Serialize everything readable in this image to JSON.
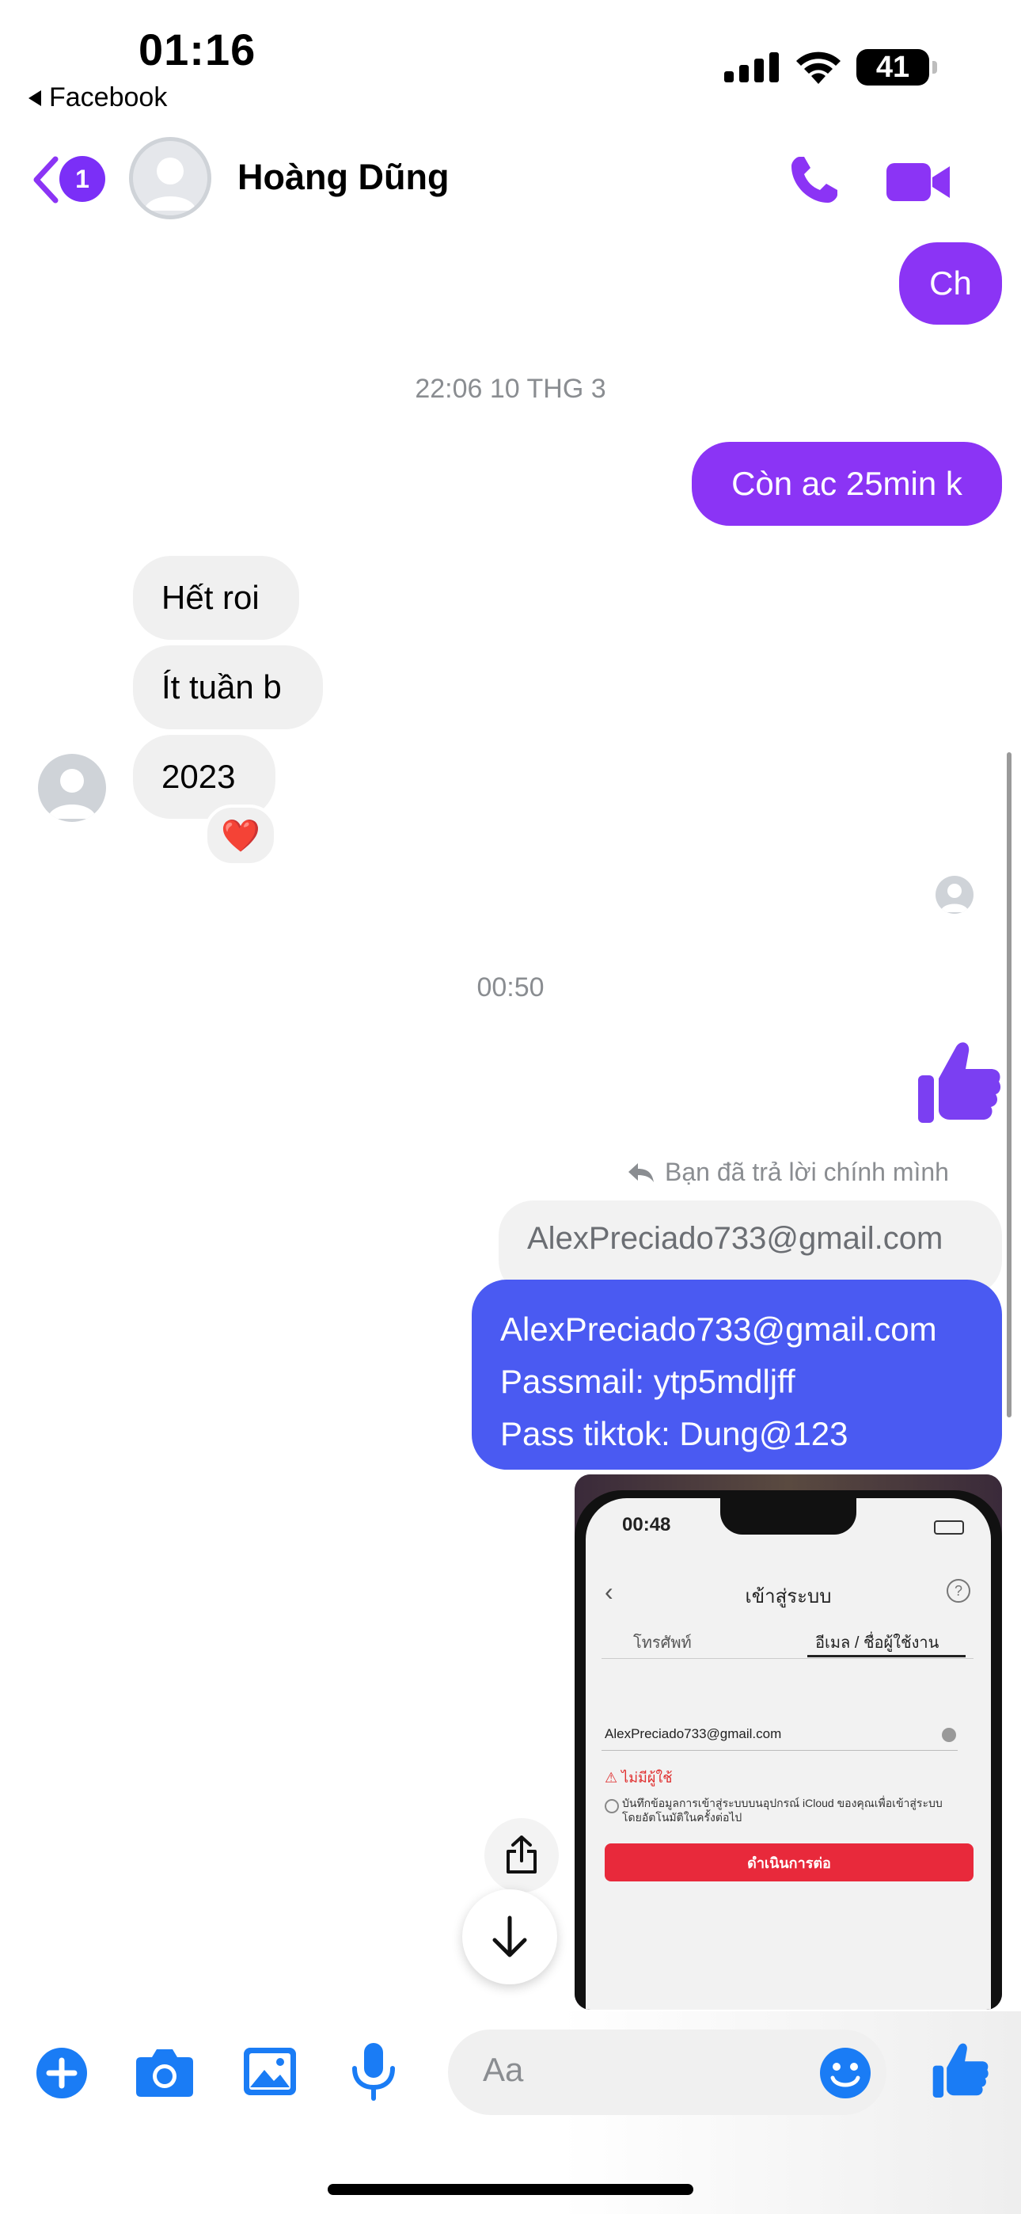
{
  "status_bar": {
    "time": "01:16",
    "back_app": "Facebook",
    "battery": "41"
  },
  "header": {
    "unread_count": "1",
    "contact_name": "Hoàng Dũng"
  },
  "messages": {
    "out1": "Ch",
    "ts1": "22:06 10 THG 3",
    "out2": "Còn ac 25min k",
    "in1": "Hết roi",
    "in2": "Ít tuần b",
    "in3": "2023",
    "reaction": "❤️",
    "ts2": "00:50",
    "reply_note": "Bạn đã trả lời chính mình",
    "quoted": "AlexPreciado733@gmail.com",
    "out3_line1": "AlexPreciado733@gmail.com",
    "out3_line2": "Passmail: ytp5mdljff",
    "out3_line3": "Pass tiktok: Dung@123"
  },
  "photo": {
    "phone_time": "00:48",
    "login_title": "เข้าสู่ระบบ",
    "tab_phone": "โทรศัพท์",
    "tab_email": "อีเมล / ชื่อผู้ใช้งาน",
    "email_value": "AlexPreciado733@gmail.com",
    "error_text": "ไม่มีผู้ใช้",
    "checkbox_text": "บันทึกข้อมูลการเข้าสู่ระบบบนอุปกรณ์ iCloud ของคุณเพื่อเข้าสู่ระบบโดยอัตโนมัติในครั้งต่อไป",
    "continue_label": "ดำเนินการต่อ"
  },
  "composer": {
    "placeholder": "Aa"
  },
  "colors": {
    "accent": "#8b34f5",
    "blue_bubble": "#4a5af2",
    "icon_blue": "#1a7cf5"
  }
}
